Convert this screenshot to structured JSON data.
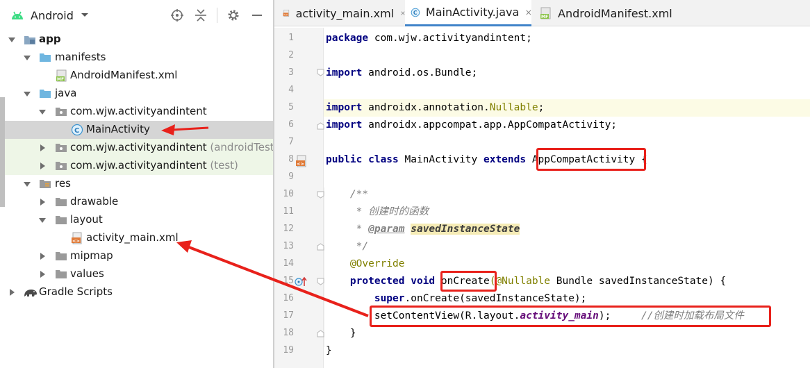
{
  "project_panel": {
    "view_label": "Android",
    "tree": [
      {
        "label": "app",
        "bold": true
      },
      {
        "label": "manifests"
      },
      {
        "label": "AndroidManifest.xml"
      },
      {
        "label": "java"
      },
      {
        "label": "com.wjw.activityandintent"
      },
      {
        "label": "MainActivity"
      },
      {
        "label": "com.wjw.activityandintent",
        "suffix": "(androidTest)"
      },
      {
        "label": "com.wjw.activityandintent",
        "suffix": "(test)"
      },
      {
        "label": "res"
      },
      {
        "label": "drawable"
      },
      {
        "label": "layout"
      },
      {
        "label": "activity_main.xml"
      },
      {
        "label": "mipmap"
      },
      {
        "label": "values"
      },
      {
        "label": "Gradle Scripts"
      }
    ]
  },
  "editor": {
    "tabs": [
      {
        "label": "activity_main.xml"
      },
      {
        "label": "MainActivity.java"
      },
      {
        "label": "AndroidManifest.xml"
      }
    ],
    "line_numbers": [
      "1",
      "2",
      "3",
      "4",
      "5",
      "6",
      "7",
      "8",
      "9",
      "10",
      "11",
      "12",
      "13",
      "14",
      "15",
      "16",
      "17",
      "18",
      "19"
    ],
    "code": {
      "l1_kw": "package",
      "l1_rest": " com.wjw.activityandintent;",
      "l3_kw": "import",
      "l3_rest": " android.os.Bundle;",
      "l5_kw": "import",
      "l5_a": " androidx.annotation.",
      "l5_ann": "Nullable",
      "l5_b": ";",
      "l6_kw": "import",
      "l6_rest": " androidx.appcompat.app.AppCompatActivity;",
      "l8_kw1": "public class",
      "l8_name": " MainActivity ",
      "l8_kw2": "extends",
      "l8_sp": " ",
      "l8_super": "AppCompatActivity",
      "l8_brace": " {",
      "l10": "    /**",
      "l11": "     * 创建时的函数",
      "l12_a": "     * ",
      "l12_tag": "@param",
      "l12_sp": " ",
      "l12_param": "savedInstanceState",
      "l13": "     */",
      "l14": "    @Override",
      "l15_ind": "    ",
      "l15_kw": "protected void",
      "l15_sp": " ",
      "l15_name": "onCreate",
      "l15_ann": "(@Nullable",
      "l15_rest": " Bundle savedInstanceState) {",
      "l16_ind": "        ",
      "l16_kw": "super",
      "l16_rest": ".onCreate(savedInstanceState);",
      "l17_a": "        setContentView(R.layout.",
      "l17_field": "activity_main",
      "l17_b": ");     ",
      "l17_cm": "//创建时加载布局文件",
      "l18": "    }",
      "l19": "}"
    }
  },
  "colors": {
    "annotation_red": "#e8211b",
    "tab_underline": "#4083c9",
    "selection": "#d5d5d5",
    "test_bg": "#eef6e7"
  }
}
